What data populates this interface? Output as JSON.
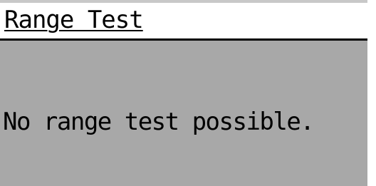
{
  "screen": {
    "title": "Range Test",
    "message": "No range test possible."
  },
  "colors": {
    "header_background": "#ffffff",
    "content_background": "#a8a8a8",
    "text": "#000000",
    "divider": "#000000"
  }
}
